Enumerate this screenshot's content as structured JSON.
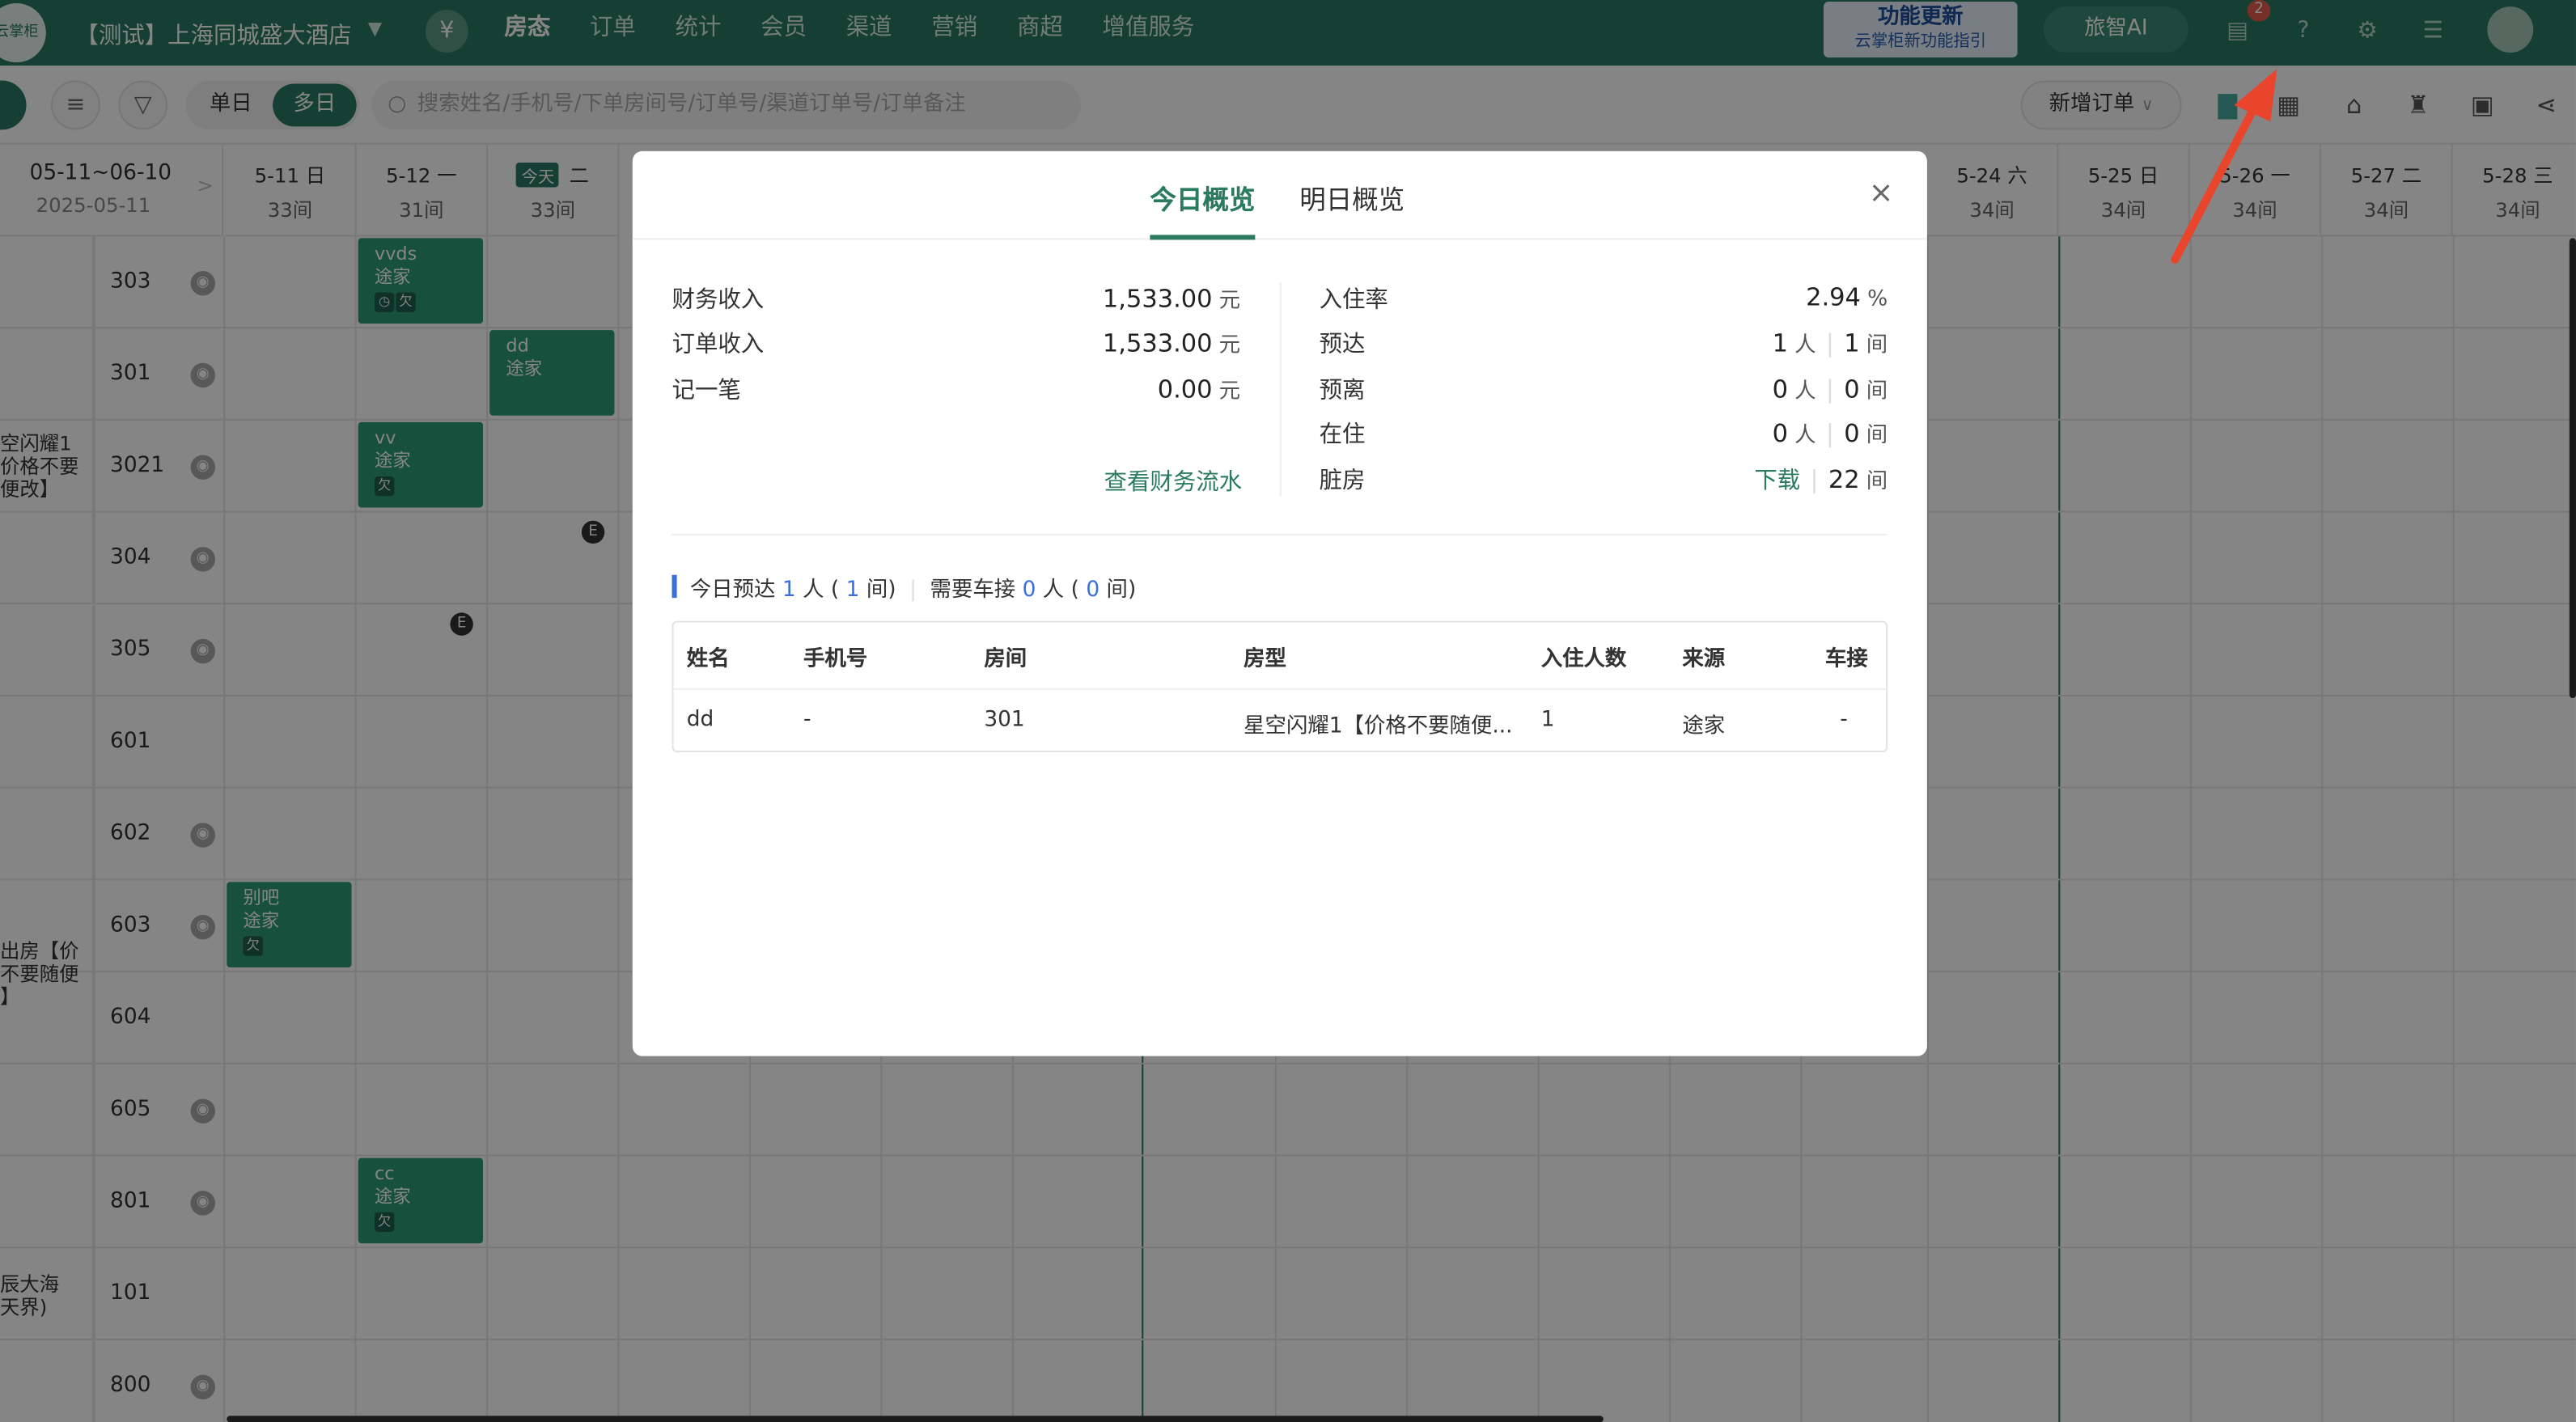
{
  "topnav": {
    "logo_text": "云掌柜",
    "hotel_name": "【测试】上海同城盛大酒店",
    "yen_symbol": "¥",
    "menu": [
      {
        "label": "房态",
        "active": true
      },
      {
        "label": "订单"
      },
      {
        "label": "统计"
      },
      {
        "label": "会员"
      },
      {
        "label": "渠道"
      },
      {
        "label": "营销"
      },
      {
        "label": "商超"
      },
      {
        "label": "增值服务"
      }
    ],
    "update_title": "功能更新",
    "update_sub": "云掌柜新功能指引",
    "ai_label": "旅智AI",
    "message_count": "2"
  },
  "toolbar": {
    "single_day": "单日",
    "multi_day": "多日",
    "search_placeholder": "搜索姓名/手机号/下单房间号/订单号/渠道订单号/订单备注",
    "new_order": "新增订单"
  },
  "calendar": {
    "range": "05-11~06-10",
    "range_date": "2025-05-11",
    "dates": [
      {
        "d": "5-11  日",
        "c": "33间"
      },
      {
        "d": "5-12  一",
        "c": "31间"
      },
      {
        "d": "二",
        "c": "33间",
        "today": "今天"
      },
      {
        "d": "5-24  六",
        "c": "34间"
      },
      {
        "d": "5-25  日",
        "c": "34间"
      },
      {
        "d": "5-26  一",
        "c": "34间"
      },
      {
        "d": "5-27  二",
        "c": "34间"
      },
      {
        "d": "5-28  三",
        "c": "34间"
      }
    ],
    "rooms": [
      "303",
      "301",
      "3021",
      "304",
      "305",
      "601",
      "602",
      "603",
      "604",
      "605",
      "801",
      "101",
      "800"
    ],
    "room_types": [
      {
        "label": "空闪耀1\n价格不要\n便改】"
      },
      {
        "label": "出房【价\n不要随便\n】"
      },
      {
        "label": "辰大海\n天界)"
      }
    ],
    "bookings": [
      {
        "name": "vvds",
        "source": "途家",
        "tags": [
          "◷",
          "欠"
        ]
      },
      {
        "name": "dd",
        "source": "途家",
        "tags": []
      },
      {
        "name": "vv",
        "source": "途家",
        "tags": [
          "欠"
        ]
      },
      {
        "name": "别吧",
        "source": "途家",
        "tags": [
          "欠"
        ]
      },
      {
        "name": "cc",
        "source": "途家",
        "tags": [
          "欠"
        ]
      }
    ]
  },
  "modal": {
    "tab_today": "今日概览",
    "tab_tomorrow": "明日概览",
    "close": "×",
    "left": [
      {
        "label": "财务收入",
        "value": "1,533.00",
        "unit": "元"
      },
      {
        "label": "订单收入",
        "value": "1,533.00",
        "unit": "元"
      },
      {
        "label": "记一笔",
        "value": "0.00",
        "unit": "元"
      }
    ],
    "finance_link": "查看财务流水",
    "right": {
      "occupancy_label": "入住率",
      "occupancy_value": "2.94",
      "occupancy_unit": "%",
      "arrive_label": "预达",
      "arrive_people": "1",
      "arrive_rooms": "1",
      "depart_label": "预离",
      "depart_people": "0",
      "depart_rooms": "0",
      "stay_label": "在住",
      "stay_people": "0",
      "stay_rooms": "0",
      "dirty_label": "脏房",
      "dirty_link": "下载",
      "dirty_rooms": "22",
      "unit_people": "人",
      "unit_rooms": "间"
    },
    "summary": {
      "prefix": "今日预达",
      "people": "1",
      "people_unit": "人 (",
      "rooms": "1",
      "rooms_unit": "间)",
      "pickup_prefix": "需要车接",
      "pickup_people": "0",
      "pickup_people_unit": "人 (",
      "pickup_rooms": "0",
      "pickup_rooms_unit": "间)"
    },
    "table": {
      "headers": [
        "姓名",
        "手机号",
        "房间",
        "房型",
        "入住人数",
        "来源",
        "车接"
      ],
      "rows": [
        [
          "dd",
          "-",
          "301",
          "星空闪耀1【价格不要随便...",
          "1",
          "途家",
          "-"
        ]
      ]
    }
  }
}
